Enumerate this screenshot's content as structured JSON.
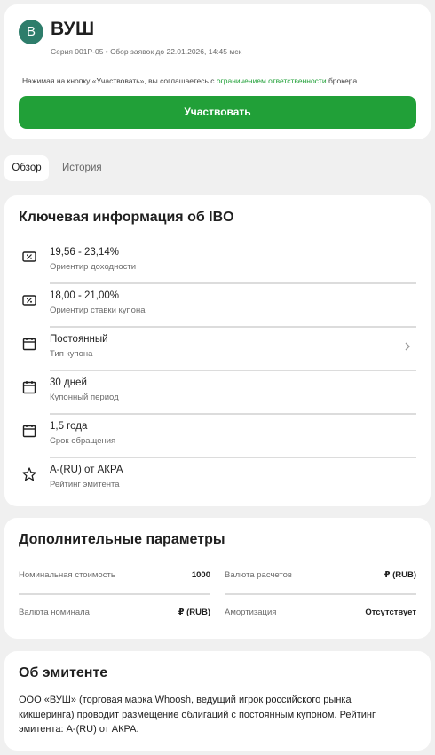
{
  "header": {
    "logo_letter": "В",
    "title": "ВУШ",
    "subtitle": "Серия 001Р-05 • Сбор заявок до 22.01.2026, 14:45 мск",
    "notice_prefix": "Нажимая на кнопку «Участвовать», вы соглашаетесь с ",
    "notice_link": "ограничением ответственности",
    "notice_suffix": " брокера",
    "participate_label": "Участвовать"
  },
  "tabs": [
    {
      "label": "Обзор",
      "active": true
    },
    {
      "label": "История",
      "active": false
    }
  ],
  "key_info": {
    "title": "Ключевая информация об IBO",
    "rows": [
      {
        "value": "19,56 - 23,14%",
        "label": "Ориентир доходности",
        "icon": "percent-ticket-icon"
      },
      {
        "value": "18,00 - 21,00%",
        "label": "Ориентир ставки купона",
        "icon": "percent-ticket-icon"
      },
      {
        "value": "Постоянный",
        "label": "Тип купона",
        "icon": "calendar-icon",
        "chevron": true
      },
      {
        "value": "30 дней",
        "label": "Купонный период",
        "icon": "calendar-icon"
      },
      {
        "value": "1,5 года",
        "label": "Срок обращения",
        "icon": "calendar-icon"
      },
      {
        "value": "A-(RU) от АКРА",
        "label": "Рейтинг эмитента",
        "icon": "star-badge-icon"
      }
    ]
  },
  "params": {
    "title": "Дополнительные параметры",
    "items": [
      {
        "label": "Номинальная стоимость",
        "value": "1000"
      },
      {
        "label": "Валюта расчетов",
        "value": "₽ (RUB)"
      },
      {
        "label": "Валюта номинала",
        "value": "₽ (RUB)"
      },
      {
        "label": "Амортизация",
        "value": "Отсутствует"
      }
    ]
  },
  "issuer": {
    "title": "Об эмитенте",
    "description": "ООО «ВУШ» (торговая марка Whoosh, ведущий игрок российского рынка кикшеринга) проводит размещение облигаций с постоянным купоном. Рейтинг эмитента: A-(RU) от АКРА."
  },
  "colors": {
    "accent": "#21a038",
    "logo_bg": "#2e7d6b",
    "background": "#f0f0f0"
  }
}
